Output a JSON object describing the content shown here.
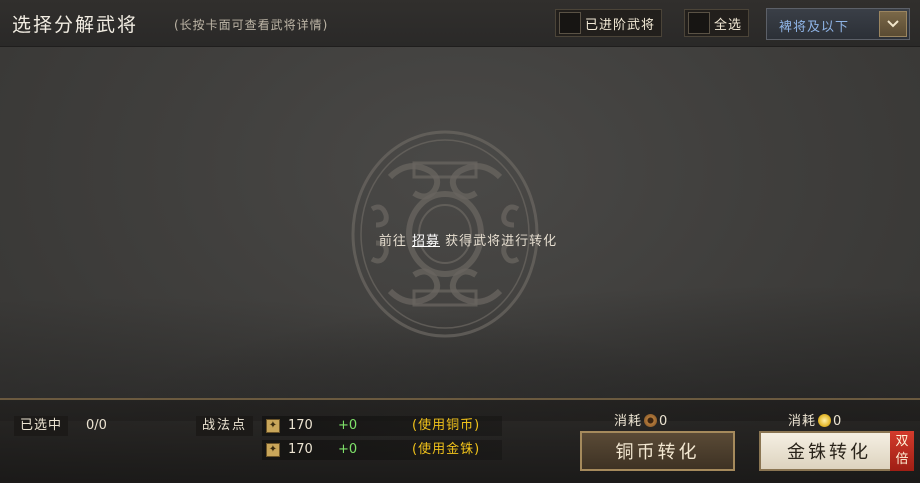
{
  "header": {
    "title": "选择分解武将",
    "subtitle": "(长按卡面可查看武将详情)",
    "filter_advanced_label": "已进阶武将",
    "filter_all_label": "全选",
    "quality_dropdown_value": "裨将及以下"
  },
  "main": {
    "empty_prefix": "前往 ",
    "empty_link": "招募",
    "empty_suffix": " 获得武将进行转化"
  },
  "bottom": {
    "selected_label": "已选中",
    "selected_count": "0/0",
    "points_label": "战法点",
    "rows": [
      {
        "value": "170",
        "gain": "+0",
        "note": "(使用铜币)"
      },
      {
        "value": "170",
        "gain": "+0",
        "note": "(使用金铢)"
      }
    ],
    "cost_label": "消耗",
    "copper_cost": "0",
    "gold_cost": "0",
    "copper_button": "铜币转化",
    "gold_button": "金铢转化",
    "double_badge": "双倍"
  },
  "icons": {
    "copper_coin": "copper-coin-icon",
    "gold_coin": "gold-coin-icon",
    "points": "battle-points-icon",
    "dropdown": "chevron-down-icon"
  },
  "colors": {
    "accent_gold": "#f0c21a",
    "gain_green": "#7fe36a",
    "badge_red": "#c8301f",
    "dropdown_text": "#8fb4e6"
  }
}
